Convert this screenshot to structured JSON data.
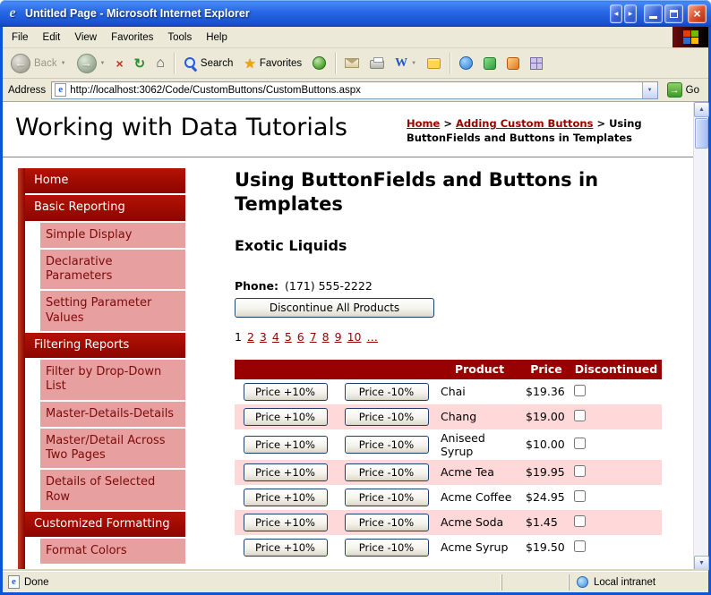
{
  "colors": {
    "maroon": "#990000",
    "section_red_top": "#b41204",
    "section_red_bottom": "#8c0500",
    "sidebar_pink": "#e89f9f",
    "row_pink": "#ffd9d9",
    "xp_blue": "#1653d4"
  },
  "icons": {
    "ie_logo_glyph": "e",
    "nav_left_glyph": "◀",
    "nav_right_glyph": "▶",
    "close_glyph": "×",
    "back_glyph": "←",
    "forward_glyph": "→",
    "dropdown_glyph": "▼",
    "stop_glyph": "×",
    "refresh_glyph": "↻",
    "home_glyph": "⌂",
    "favorites_glyph": "★",
    "edit_glyph": "W",
    "go_glyph": "→",
    "up_arrow_glyph": "▲",
    "down_arrow_glyph": "▼",
    "page_icon_glyph": "e"
  },
  "window": {
    "title": "Untitled Page - Microsoft Internet Explorer"
  },
  "menu": {
    "items": [
      "File",
      "Edit",
      "View",
      "Favorites",
      "Tools",
      "Help"
    ]
  },
  "toolbar": {
    "back_label": "Back",
    "search_label": "Search",
    "favorites_label": "Favorites"
  },
  "address": {
    "label": "Address",
    "url": "http://localhost:3062/Code/CustomButtons/CustomButtons.aspx",
    "go_label": "Go"
  },
  "page": {
    "site_title": "Working with Data Tutorials",
    "breadcrumb": {
      "links": [
        "Home",
        "Adding Custom Buttons"
      ],
      "current": "Using ButtonFields and Buttons in Templates",
      "separator": ">"
    },
    "sidebar": [
      {
        "label": "Home",
        "level": 1
      },
      {
        "label": "Basic Reporting",
        "level": 1
      },
      {
        "label": "Simple Display",
        "level": 2
      },
      {
        "label": "Declarative Parameters",
        "level": 2
      },
      {
        "label": "Setting Parameter Values",
        "level": 2
      },
      {
        "label": "Filtering Reports",
        "level": 1
      },
      {
        "label": "Filter by Drop-Down List",
        "level": 2
      },
      {
        "label": "Master-Details-Details",
        "level": 2
      },
      {
        "label": "Master/Detail Across Two Pages",
        "level": 2
      },
      {
        "label": "Details of Selected Row",
        "level": 2
      },
      {
        "label": "Customized Formatting",
        "level": 1
      },
      {
        "label": "Format Colors",
        "level": 2
      }
    ],
    "main": {
      "heading": "Using ButtonFields and Buttons in Templates",
      "supplier_name": "Exotic Liquids",
      "phone_label": "Phone:",
      "phone_number": "(171) 555-2222",
      "discontinue_all_label": "Discontinue All Products",
      "pager": {
        "current": "1",
        "pages": [
          "2",
          "3",
          "4",
          "5",
          "6",
          "7",
          "8",
          "9",
          "10",
          "…"
        ]
      },
      "grid": {
        "headers": [
          "",
          "",
          "Product",
          "Price",
          "Discontinued"
        ],
        "price_up_label": "Price +10%",
        "price_down_label": "Price -10%",
        "rows": [
          {
            "product": "Chai",
            "price": "$19.36",
            "discontinued": false
          },
          {
            "product": "Chang",
            "price": "$19.00",
            "discontinued": false
          },
          {
            "product": "Aniseed Syrup",
            "price": "$10.00",
            "discontinued": false
          },
          {
            "product": "Acme Tea",
            "price": "$19.95",
            "discontinued": false
          },
          {
            "product": "Acme Coffee",
            "price": "$24.95",
            "discontinued": false
          },
          {
            "product": "Acme Soda",
            "price": "$1.45",
            "discontinued": false
          },
          {
            "product": "Acme Syrup",
            "price": "$19.50",
            "discontinued": false
          }
        ]
      }
    }
  },
  "statusbar": {
    "status": "Done",
    "zone": "Local intranet"
  }
}
